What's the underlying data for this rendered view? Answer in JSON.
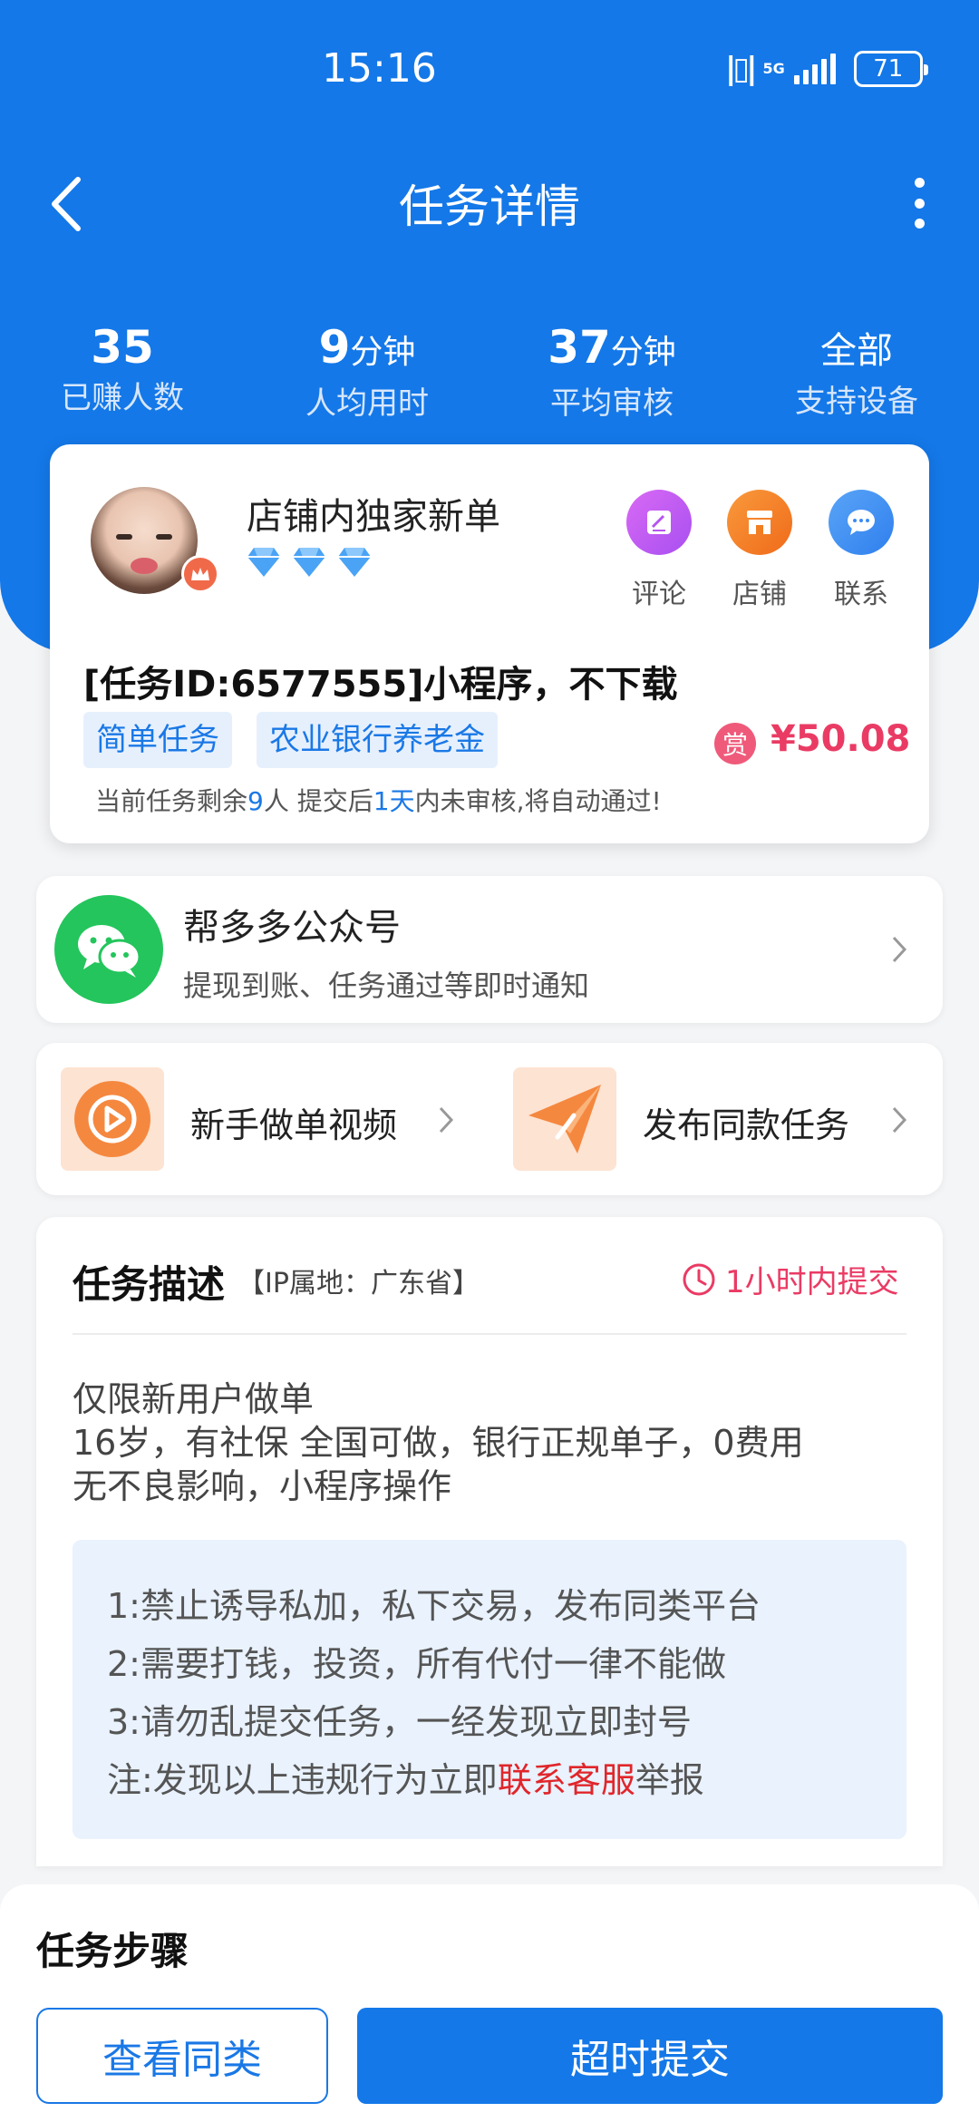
{
  "status_bar": {
    "time": "15:16",
    "network": "5G",
    "battery": "71"
  },
  "nav": {
    "title": "任务详情",
    "back_icon": "chevron-left-icon",
    "more_icon": "more-vertical-icon"
  },
  "stats": [
    {
      "value": "35",
      "unit": "",
      "label": "已赚人数"
    },
    {
      "value": "9",
      "unit": "分钟",
      "label": "人均用时"
    },
    {
      "value": "37",
      "unit": "分钟",
      "label": "平均审核"
    },
    {
      "value": "全部",
      "unit": "",
      "label": "支持设备"
    }
  ],
  "shop": {
    "name": "店铺内独家新单",
    "level_diamonds": 3
  },
  "actions": [
    {
      "label": "评论",
      "icon": "comment-icon",
      "color": "#c44ff0"
    },
    {
      "label": "店铺",
      "icon": "store-icon",
      "color": "#f2781e"
    },
    {
      "label": "联系",
      "icon": "chat-icon",
      "color": "#3b8cf0"
    }
  ],
  "task": {
    "title": "[任务ID:6577555]小程序，不下载",
    "tags": [
      "简单任务",
      "农业银行养老金"
    ],
    "reward_badge": "赏",
    "reward": "¥50.08",
    "note_prefix": "当前任务剩余",
    "note_remaining": "9",
    "note_mid": "人  提交后",
    "note_days": "1天",
    "note_suffix": "内未审核,将自动通过!"
  },
  "wechat": {
    "title": "帮多多公众号",
    "subtitle": "提现到账、任务通过等即时通知"
  },
  "quick": {
    "video_label": "新手做单视频",
    "publish_label": "发布同款任务"
  },
  "description": {
    "title": "任务描述",
    "ip": "【IP属地：广东省】",
    "deadline": "1小时内提交",
    "lines": [
      "仅限新用户做单",
      "16岁，有社保 全国可做，银行正规单子，0费用",
      "无不良影响，小程序操作"
    ],
    "rules": [
      "1:禁止诱导私加，私下交易，发布同类平台",
      "2:需要打钱，投资，所有代付一律不能做",
      "3:请勿乱提交任务，一经发现立即封号"
    ],
    "rule_note_prefix": "注:发现以上违规行为立即",
    "rule_note_link": "联系客服",
    "rule_note_suffix": "举报"
  },
  "bottom": {
    "steps_title": "任务步骤",
    "view_similar": "查看同类",
    "submit": "超时提交"
  }
}
